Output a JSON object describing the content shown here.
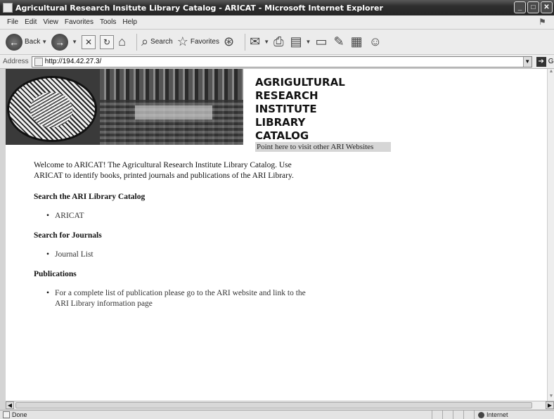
{
  "window": {
    "title": "Agricultural Research Insitute Library Catalog - ARICAT - Microsoft Internet Explorer"
  },
  "menu": [
    "File",
    "Edit",
    "View",
    "Favorites",
    "Tools",
    "Help"
  ],
  "toolbar": {
    "back_label": "Back",
    "search_label": "Search",
    "favorites_label": "Favorites"
  },
  "address": {
    "label": "Address",
    "url": "http://194.42.27.3/",
    "go_label": "Go"
  },
  "header": {
    "title_lines": [
      "AGRIGULTURAL",
      "RESEARCH",
      "INSTITUTE",
      "LIBRARY",
      "CATALOG"
    ],
    "ari_sites_link": "Point here to visit other ARI Websites"
  },
  "content": {
    "welcome": "Welcome to ARICAT! The Agricultural Research Institute Library Catalog. Use ARICAT to identify books, printed journals and publications of the ARI Library.",
    "sections": [
      {
        "heading": "Search the ARI Library Catalog",
        "items": [
          "ARICAT"
        ]
      },
      {
        "heading": "Search for Journals",
        "items": [
          "Journal List"
        ]
      },
      {
        "heading": "Publications",
        "items": [
          "For a complete list of publication please go to the ARI website and link to the ARI Library information page"
        ]
      }
    ]
  },
  "status": {
    "text": "Done",
    "zone": "Internet"
  }
}
